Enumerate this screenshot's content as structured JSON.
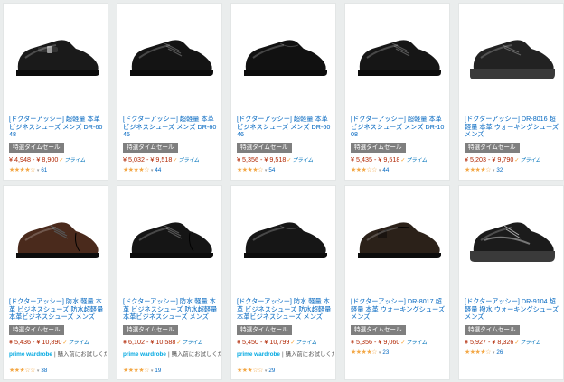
{
  "badge_label": "特選タイムセール",
  "prime_label": "プライム",
  "pw_brand": "prime wardrobe",
  "pw_note": "購入前にお試しください。",
  "products": [
    {
      "title": "[ドクターアッシー] 超軽量 本革 ビジネスシューズ メンズ DR-6048",
      "price": "¥ 4,948 - ¥ 8,900",
      "stars": "★★★★☆",
      "rating_count": "61",
      "pw": false,
      "style": "monk",
      "color": "#1a1a1a"
    },
    {
      "title": "[ドクターアッシー] 超軽量 本革 ビジネスシューズ メンズ DR-6045",
      "price": "¥ 5,032 - ¥ 9,518",
      "stars": "★★★★☆",
      "rating_count": "44",
      "pw": false,
      "style": "lace",
      "color": "#141414"
    },
    {
      "title": "[ドクターアッシー] 超軽量 本革 ビジネスシューズ メンズ DR-6046",
      "price": "¥ 5,356 - ¥ 9,518",
      "stars": "★★★★☆",
      "rating_count": "54",
      "pw": false,
      "style": "plain",
      "color": "#111111"
    },
    {
      "title": "[ドクターアッシー] 超軽量 本革 ビジネスシューズ メンズ DR-1008",
      "price": "¥ 5,435 - ¥ 9,518",
      "stars": "★★★☆☆",
      "rating_count": "44",
      "pw": false,
      "style": "lace",
      "color": "#161616"
    },
    {
      "title": "[ドクターアッシー] DR-8016 超軽量 本革 ウォーキングシューズ メンズ",
      "price": "¥ 5,203 - ¥ 9,790",
      "stars": "★★★★☆",
      "rating_count": "32",
      "pw": false,
      "style": "walk",
      "color": "#222222"
    },
    {
      "title": "[ドクターアッシー] 防水 軽量 本革 ビジネスシューズ 防水超軽量本革ビジネスシューズ メンズ",
      "price": "¥ 5,436 - ¥ 10,890",
      "stars": "★★★☆☆",
      "rating_count": "38",
      "pw": true,
      "style": "cap",
      "color": "#4a2a1c"
    },
    {
      "title": "[ドクターアッシー] 防水 軽量 本革 ビジネスシューズ 防水超軽量本革ビジネスシューズ メンズ",
      "price": "¥ 6,102 - ¥ 10,588",
      "stars": "★★★★☆",
      "rating_count": "19",
      "pw": true,
      "style": "cap",
      "color": "#151515"
    },
    {
      "title": "[ドクターアッシー] 防水 軽量 本革 ビジネスシューズ 防水超軽量本革ビジネスシューズ メンズ",
      "price": "¥ 5,450 - ¥ 10,799",
      "stars": "★★★☆☆",
      "rating_count": "29",
      "pw": true,
      "style": "plain",
      "color": "#161616"
    },
    {
      "title": "[ドクターアッシー] DR-8017 超軽量 本革 ウォーキングシューズ メンズ",
      "price": "¥ 5,356 - ¥ 9,060",
      "stars": "★★★★☆",
      "rating_count": "23",
      "pw": false,
      "style": "slipon",
      "color": "#2b2119"
    },
    {
      "title": "[ドクターアッシー] DR-9104 超軽量 撥水 ウォーキングシューズ メンズ",
      "price": "¥ 5,927 - ¥ 8,326",
      "stars": "★★★★☆",
      "rating_count": "26",
      "pw": false,
      "style": "sneaker",
      "color": "#1b1b1b"
    }
  ]
}
